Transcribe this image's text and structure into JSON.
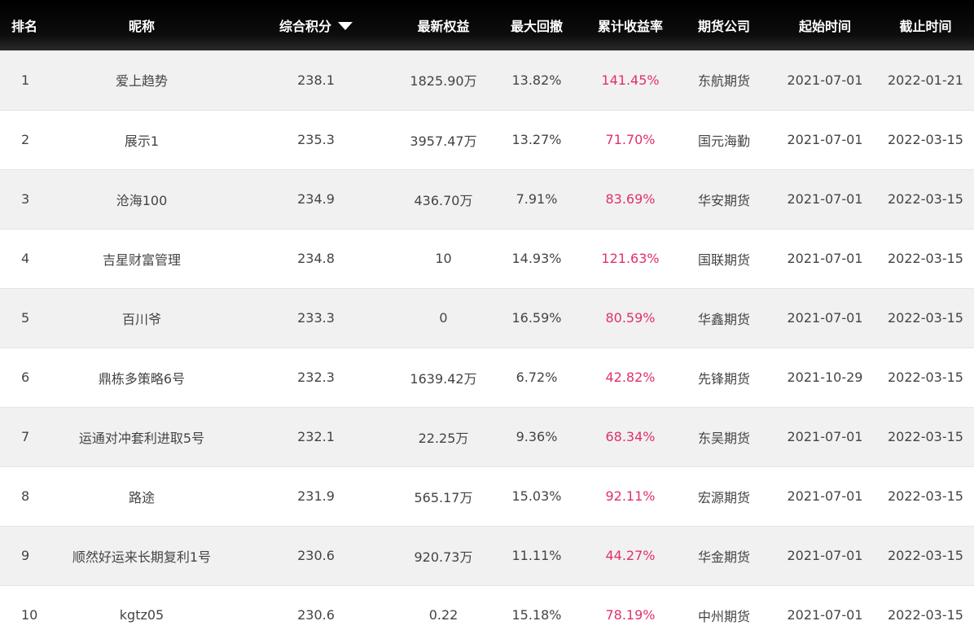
{
  "table": {
    "headers": {
      "rank": "排名",
      "nickname": "昵称",
      "score": "综合积分",
      "equity": "最新权益",
      "drawdown": "最大回撤",
      "return": "累计收益率",
      "company": "期货公司",
      "start": "起始时间",
      "end": "截止时间"
    },
    "sort_icon": "triangle-down-icon",
    "colors": {
      "header_bg": "#000000",
      "header_text": "#ffffff",
      "row_odd_bg": "#f1f1f1",
      "row_even_bg": "#ffffff",
      "return_text": "#e0306e",
      "body_text": "#444444"
    },
    "rows": [
      {
        "rank": "1",
        "nickname": "爱上趋势",
        "score": "238.1",
        "equity": "1825.90万",
        "drawdown": "13.82%",
        "return": "141.45%",
        "company": "东航期货",
        "start": "2021-07-01",
        "end": "2022-01-21"
      },
      {
        "rank": "2",
        "nickname": "展示1",
        "score": "235.3",
        "equity": "3957.47万",
        "drawdown": "13.27%",
        "return": "71.70%",
        "company": "国元海勤",
        "start": "2021-07-01",
        "end": "2022-03-15"
      },
      {
        "rank": "3",
        "nickname": "沧海100",
        "score": "234.9",
        "equity": "436.70万",
        "drawdown": "7.91%",
        "return": "83.69%",
        "company": "华安期货",
        "start": "2021-07-01",
        "end": "2022-03-15"
      },
      {
        "rank": "4",
        "nickname": "吉星财富管理",
        "score": "234.8",
        "equity": "10",
        "drawdown": "14.93%",
        "return": "121.63%",
        "company": "国联期货",
        "start": "2021-07-01",
        "end": "2022-03-15"
      },
      {
        "rank": "5",
        "nickname": "百川爷",
        "score": "233.3",
        "equity": "0",
        "drawdown": "16.59%",
        "return": "80.59%",
        "company": "华鑫期货",
        "start": "2021-07-01",
        "end": "2022-03-15"
      },
      {
        "rank": "6",
        "nickname": "鼎栋多策略6号",
        "score": "232.3",
        "equity": "1639.42万",
        "drawdown": "6.72%",
        "return": "42.82%",
        "company": "先锋期货",
        "start": "2021-10-29",
        "end": "2022-03-15"
      },
      {
        "rank": "7",
        "nickname": "运通对冲套利进取5号",
        "score": "232.1",
        "equity": "22.25万",
        "drawdown": "9.36%",
        "return": "68.34%",
        "company": "东吴期货",
        "start": "2021-07-01",
        "end": "2022-03-15"
      },
      {
        "rank": "8",
        "nickname": "路途",
        "score": "231.9",
        "equity": "565.17万",
        "drawdown": "15.03%",
        "return": "92.11%",
        "company": "宏源期货",
        "start": "2021-07-01",
        "end": "2022-03-15"
      },
      {
        "rank": "9",
        "nickname": "顺然好运来长期复利1号",
        "score": "230.6",
        "equity": "920.73万",
        "drawdown": "11.11%",
        "return": "44.27%",
        "company": "华金期货",
        "start": "2021-07-01",
        "end": "2022-03-15"
      },
      {
        "rank": "10",
        "nickname": "kgtz05",
        "score": "230.6",
        "equity": "0.22",
        "drawdown": "15.18%",
        "return": "78.19%",
        "company": "中州期货",
        "start": "2021-07-01",
        "end": "2022-03-15"
      }
    ]
  }
}
